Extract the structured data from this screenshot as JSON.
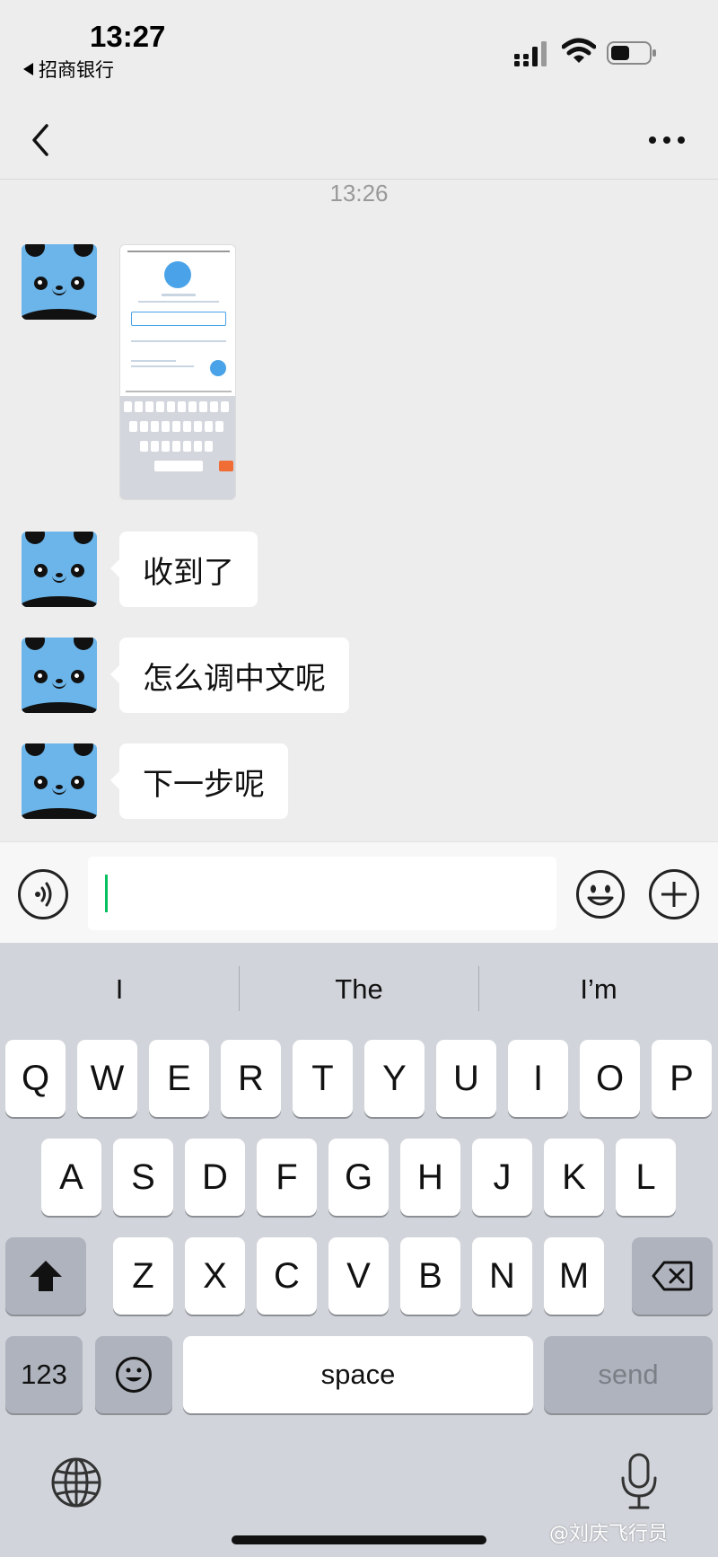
{
  "status_bar": {
    "time": "13:27",
    "back_app": "招商银行",
    "icons": [
      "signal-icon",
      "wifi-icon",
      "battery-icon"
    ]
  },
  "nav": {
    "back_icon": "chevron-left-icon",
    "more_icon": "more-dots-icon"
  },
  "chat": {
    "timestamp": "13:26",
    "messages": [
      {
        "type": "image",
        "avatar": "panda-avatar"
      },
      {
        "type": "text",
        "text": "收到了"
      },
      {
        "type": "text",
        "text": "怎么调中文呢"
      },
      {
        "type": "text",
        "text": "下一步呢"
      }
    ]
  },
  "input_bar": {
    "voice_icon": "voice-icon",
    "value": "",
    "emoji_icon": "emoji-icon",
    "plus_icon": "plus-circle-icon",
    "caret_color": "#07c160"
  },
  "keyboard": {
    "suggestions": [
      "I",
      "The",
      "I’m"
    ],
    "row1": [
      "Q",
      "W",
      "E",
      "R",
      "T",
      "Y",
      "U",
      "I",
      "O",
      "P"
    ],
    "row2": [
      "A",
      "S",
      "D",
      "F",
      "G",
      "H",
      "J",
      "K",
      "L"
    ],
    "row3": [
      "Z",
      "X",
      "C",
      "V",
      "B",
      "N",
      "M"
    ],
    "numbers_key": "123",
    "space_key": "space",
    "send_key": "send",
    "shift_icon": "shift-icon",
    "delete_icon": "backspace-icon",
    "emoji_key_icon": "emoji-icon",
    "globe_icon": "globe-icon",
    "mic_icon": "microphone-icon"
  },
  "watermark": "@刘庆飞行员"
}
